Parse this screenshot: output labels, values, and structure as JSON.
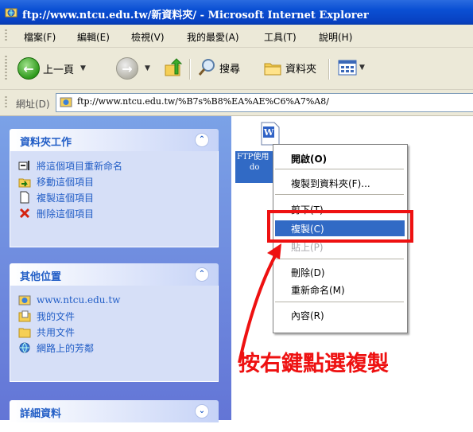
{
  "window": {
    "title": "ftp://www.ntcu.edu.tw/新資料夾/ - Microsoft Internet Explorer"
  },
  "menu": {
    "items": [
      "檔案(F)",
      "編輯(E)",
      "檢視(V)",
      "我的最愛(A)",
      "工具(T)",
      "說明(H)"
    ]
  },
  "toolbar": {
    "back_label": "上一頁",
    "search_label": "搜尋",
    "folders_label": "資料夾"
  },
  "address": {
    "label": "網址(D)",
    "value": "ftp://www.ntcu.edu.tw/%B7s%B8%EA%AE%C6%A7%A8/"
  },
  "sidebar": {
    "folder_tasks": {
      "title": "資料夾工作",
      "items": [
        "將這個項目重新命名",
        "移動這個項目",
        "複製這個項目",
        "刪除這個項目"
      ]
    },
    "other_places": {
      "title": "其他位置",
      "items": [
        "www.ntcu.edu.tw",
        "我的文件",
        "共用文件",
        "網路上的芳鄰"
      ]
    },
    "details": {
      "title": "詳細資料"
    }
  },
  "file": {
    "name_line1": "FTP使用",
    "name_line2": "do"
  },
  "context_menu": {
    "items": [
      "開啟(O)",
      "複製到資料夾(F)...",
      "剪下(T)",
      "複製(C)",
      "貼上(P)",
      "刪除(D)",
      "重新命名(M)",
      "內容(R)"
    ]
  },
  "annotation": {
    "text": "按右鍵點選複製"
  },
  "colors": {
    "highlight": "#316ac5",
    "annotation": "#ee1111",
    "task_link": "#215dc6"
  }
}
